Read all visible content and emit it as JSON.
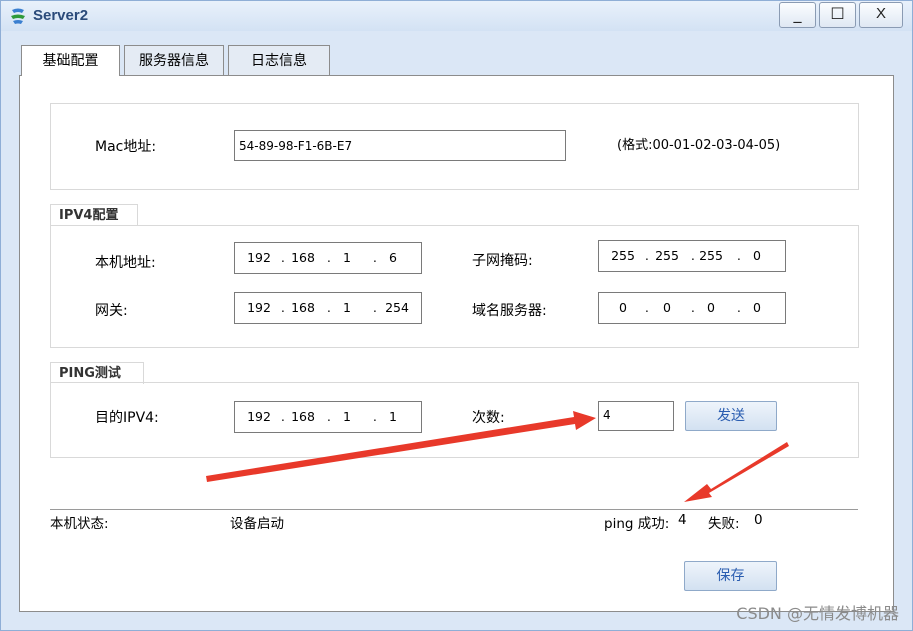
{
  "window": {
    "title": "Server2",
    "minimize_glyph": "_",
    "maximize_glyph": "☐",
    "close_glyph": "X"
  },
  "tabs": [
    "基础配置",
    "服务器信息",
    "日志信息"
  ],
  "mac": {
    "label": "Mac地址:",
    "value": "54-89-98-F1-6B-E7",
    "hint": "(格式:00-01-02-03-04-05)"
  },
  "ipv4": {
    "group_title": "IPV4配置",
    "local_addr_label": "本机地址:",
    "local_addr": [
      "192",
      "168",
      "1",
      "6"
    ],
    "mask_label": "子网掩码:",
    "mask": [
      "255",
      "255",
      "255",
      "0"
    ],
    "gateway_label": "网关:",
    "gateway": [
      "192",
      "168",
      "1",
      "254"
    ],
    "dns_label": "域名服务器:",
    "dns": [
      "0",
      "0",
      "0",
      "0"
    ]
  },
  "ping": {
    "group_title": "PING测试",
    "target_label": "目的IPV4:",
    "target": [
      "192",
      "168",
      "1",
      "1"
    ],
    "count_label": "次数:",
    "count": "4",
    "send_label": "发送"
  },
  "status": {
    "label": "本机状态:",
    "value": "设备启动",
    "ping_success_label": "ping 成功:",
    "ping_success": "4",
    "fail_label": "失败:",
    "fail": "0"
  },
  "save_label": "保存",
  "watermark": "CSDN @无情发博机器",
  "colors": {
    "annotation_arrow": "#e8392a",
    "button_text": "#2a5db0"
  }
}
